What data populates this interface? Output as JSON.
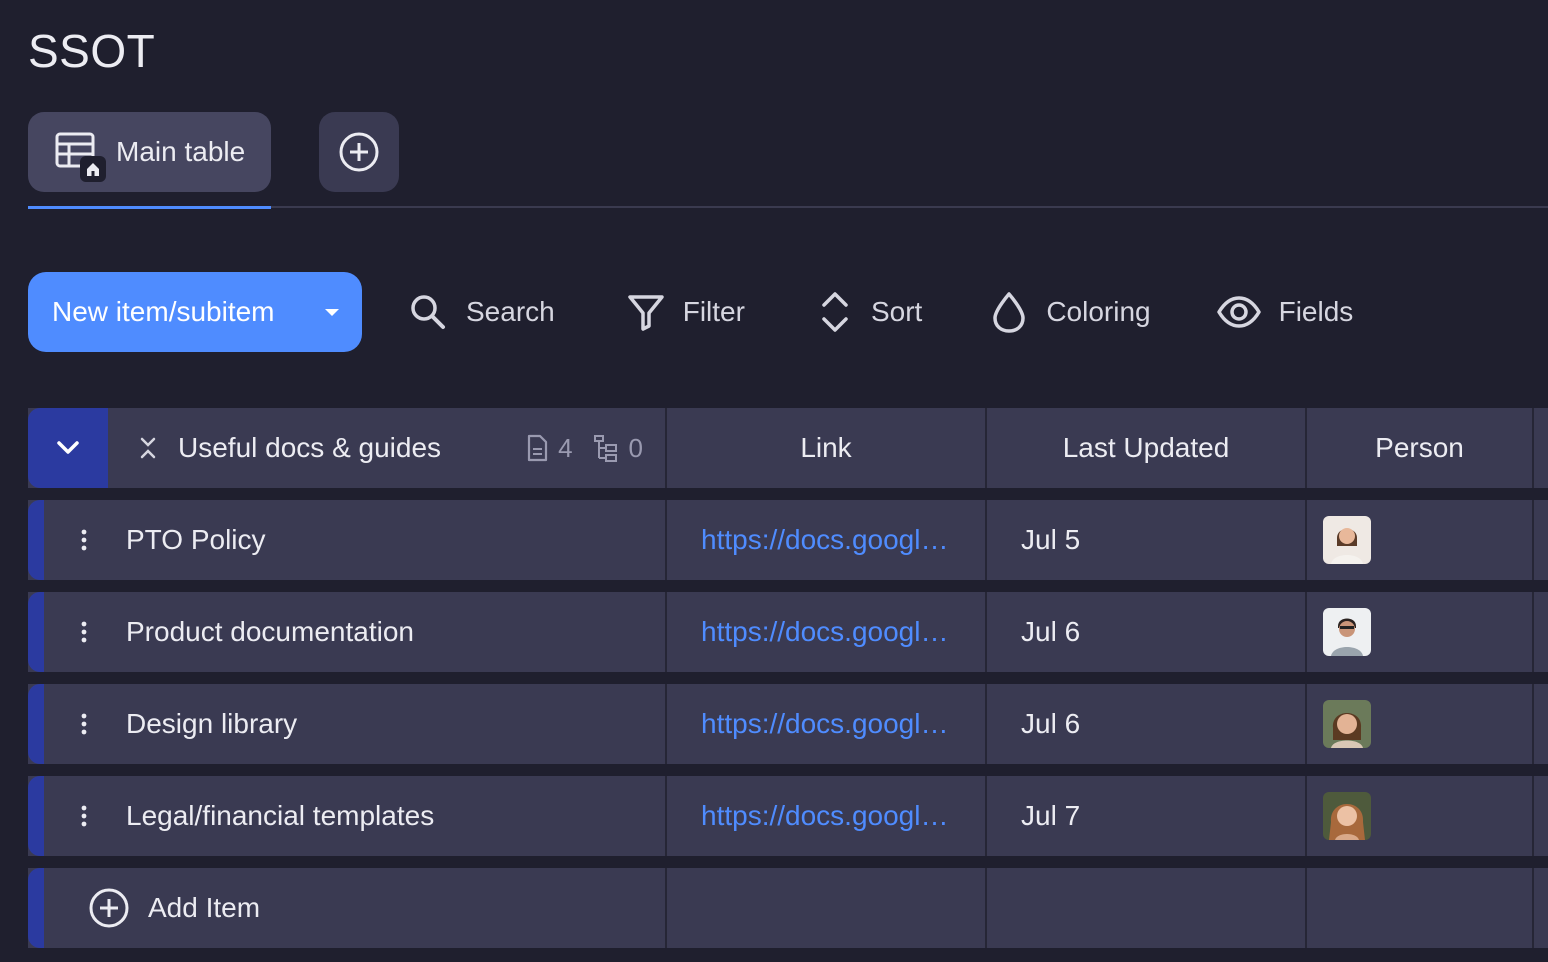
{
  "board": {
    "title": "SSOT"
  },
  "tabs": [
    {
      "label": "Main table",
      "icon": "table-home-icon",
      "active": true
    }
  ],
  "toolbar": {
    "new_item_label": "New item/subitem",
    "search_label": "Search",
    "filter_label": "Filter",
    "sort_label": "Sort",
    "coloring_label": "Coloring",
    "fields_label": "Fields"
  },
  "group": {
    "title": "Useful docs & guides",
    "items_count": "4",
    "subitems_count": "0",
    "accent_color": "#2b3aa0",
    "columns": [
      "Link",
      "Last Updated",
      "Person"
    ]
  },
  "rows": [
    {
      "name": "PTO Policy",
      "link": "https://docs.googl…",
      "date": "Jul 5",
      "person": "avatar-woman-1"
    },
    {
      "name": "Product documentation",
      "link": "https://docs.googl…",
      "date": "Jul 6",
      "person": "avatar-man-1"
    },
    {
      "name": "Design library",
      "link": "https://docs.googl…",
      "date": "Jul 6",
      "person": "avatar-woman-2"
    },
    {
      "name": "Legal/financial templates",
      "link": "https://docs.googl…",
      "date": "Jul 7",
      "person": "avatar-woman-3"
    }
  ],
  "add_item_label": "Add Item",
  "colors": {
    "accent": "#4f8cff",
    "background": "#1f1f2e",
    "row": "#3a3a52",
    "group": "#2b3aa0"
  }
}
